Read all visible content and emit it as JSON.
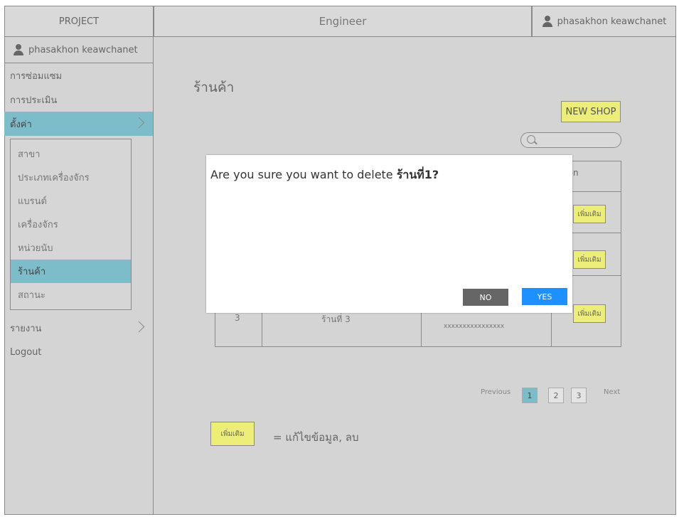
{
  "header": {
    "project": "PROJECT",
    "title": "Engineer",
    "user": "phasakhon keawchanet"
  },
  "sidebar": {
    "user": "phasakhon keawchanet",
    "items": [
      {
        "label": "การซ่อมแซม"
      },
      {
        "label": "การประเมิน"
      },
      {
        "label": "ตั้งค่า"
      }
    ],
    "submenu": [
      {
        "label": "สาขา"
      },
      {
        "label": "ประเภทเครื่องจักร"
      },
      {
        "label": "แบรนด์"
      },
      {
        "label": "เครื่องจักร"
      },
      {
        "label": "หน่วยนับ"
      },
      {
        "label": "ร้านค้า"
      },
      {
        "label": "สถานะ"
      }
    ],
    "bottom": [
      {
        "label": "รายงาน"
      },
      {
        "label": "Logout"
      }
    ]
  },
  "main": {
    "title": "ร้านค้า",
    "new_shop": "NEW SHOP",
    "table": {
      "action_header": "Action",
      "edit_label": "เพิ่มเติม",
      "row3_no": "3",
      "row3_name": "ร้านที่ 3",
      "row3_detail": "xxxxxxxxxxxxxxxx"
    },
    "pager": {
      "previous": "Previous",
      "pages": [
        "1",
        "2",
        "3"
      ],
      "next": "Next"
    },
    "legend": {
      "button": "เพิ่มเติม",
      "text": "= แก้ไขข้อมูล, ลบ"
    }
  },
  "modal": {
    "message": "Are you sure you want to delete ",
    "target": "ร้านที่1?",
    "no": "NO",
    "yes": "YES"
  },
  "colors": {
    "accent": "#7dbdc9",
    "button_yellow": "#eded79",
    "yes_blue": "#1e90ff",
    "no_gray": "#666666"
  }
}
